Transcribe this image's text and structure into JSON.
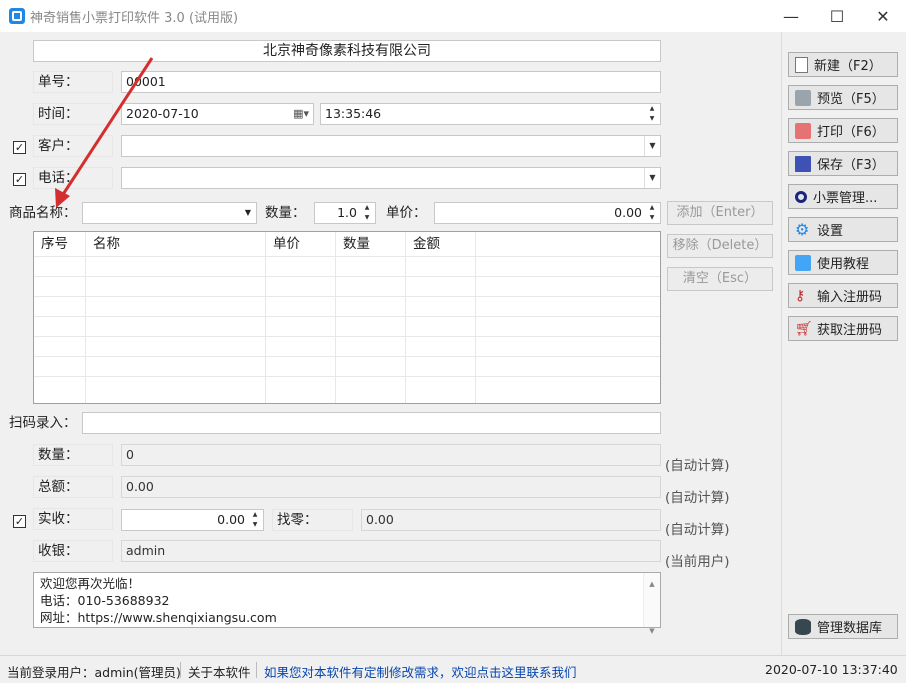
{
  "window": {
    "title": "神奇销售小票打印软件 3.0 (试用版)",
    "min": "—",
    "max": "☐",
    "close": "✕"
  },
  "header_company": "北京神奇像素科技有限公司",
  "form": {
    "order_label": "单号：",
    "order_value": "00001",
    "time_label": "时间：",
    "date_value": "2020-07-10",
    "time_value": "13:35:46",
    "customer_label": "客户：",
    "customer_checked": true,
    "customer_value": "",
    "phone_label": "电话：",
    "phone_checked": true,
    "phone_value": ""
  },
  "product": {
    "name_label": "商品名称：",
    "name_value": "",
    "qty_label": "数量：",
    "qty_value": "1.0",
    "price_label": "单价：",
    "price_value": "0.00"
  },
  "actions": {
    "add": "添加（Enter）",
    "remove": "移除（Delete）",
    "clear": "清空（Esc）"
  },
  "table": {
    "columns": [
      "序号",
      "名称",
      "单价",
      "数量",
      "金额"
    ],
    "rows": []
  },
  "scan": {
    "label": "扫码录入：",
    "value": ""
  },
  "summary": {
    "qty_label": "数量：",
    "qty_value": "0",
    "qty_note": "(自动计算)",
    "total_label": "总额：",
    "total_value": "0.00",
    "total_note": "(自动计算)",
    "paid_label": "实收：",
    "paid_checked": true,
    "paid_value": "0.00",
    "change_label": "找零：",
    "change_value": "0.00",
    "paid_note": "(自动计算)",
    "cashier_label": "收银：",
    "cashier_value": "admin",
    "cashier_note": "(当前用户)"
  },
  "message": {
    "line1": "欢迎您再次光临！",
    "line2": "电话：010-53688932",
    "line3": "网址：https://www.shenqixiangsu.com"
  },
  "sidebar": {
    "new": "新建（F2）",
    "preview": "预览（F5）",
    "print": "打印（F6）",
    "save": "保存（F3）",
    "manage": "小票管理...",
    "settings": "设置",
    "tutorial": "使用教程",
    "enter_code": "输入注册码",
    "get_code": "获取注册码",
    "database": "管理数据库"
  },
  "status": {
    "user": "当前登录用户：admin(管理员)",
    "about": "关于本软件",
    "contact": "如果您对本软件有定制修改需求，欢迎点击这里联系我们",
    "datetime": "2020-07-10 13:37:40"
  },
  "colors": {
    "accent": "#1e88e5",
    "link": "#0645ad",
    "annotation": "#d32f2f"
  }
}
